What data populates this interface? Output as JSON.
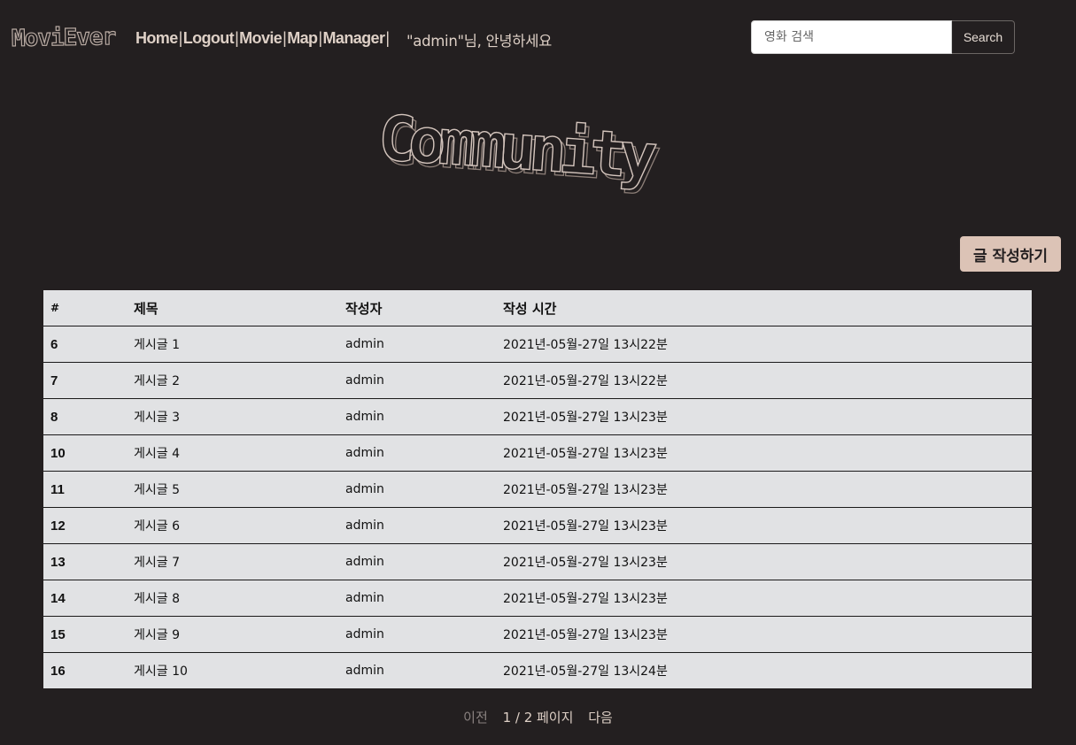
{
  "header": {
    "logo": "MoviEver",
    "nav": [
      "Home",
      "Logout",
      "Movie",
      "Map",
      "Manager"
    ],
    "nav_separator": "|",
    "greeting": "\"admin\"님, 안녕하세요",
    "search": {
      "placeholder": "영화 검색",
      "button_label": "Search"
    }
  },
  "main": {
    "title": "Community",
    "write_button_label": "글 작성하기"
  },
  "table": {
    "columns": [
      "#",
      "제목",
      "작성자",
      "작성 시간"
    ],
    "rows": [
      {
        "num": "6",
        "title": "게시글 1",
        "author": "admin",
        "time": "2021년-05월-27일 13시22분"
      },
      {
        "num": "7",
        "title": "게시글 2",
        "author": "admin",
        "time": "2021년-05월-27일 13시22분"
      },
      {
        "num": "8",
        "title": "게시글 3",
        "author": "admin",
        "time": "2021년-05월-27일 13시23분"
      },
      {
        "num": "10",
        "title": "게시글 4",
        "author": "admin",
        "time": "2021년-05월-27일 13시23분"
      },
      {
        "num": "11",
        "title": "게시글 5",
        "author": "admin",
        "time": "2021년-05월-27일 13시23분"
      },
      {
        "num": "12",
        "title": "게시글 6",
        "author": "admin",
        "time": "2021년-05월-27일 13시23분"
      },
      {
        "num": "13",
        "title": "게시글 7",
        "author": "admin",
        "time": "2021년-05월-27일 13시23분"
      },
      {
        "num": "14",
        "title": "게시글 8",
        "author": "admin",
        "time": "2021년-05월-27일 13시23분"
      },
      {
        "num": "15",
        "title": "게시글 9",
        "author": "admin",
        "time": "2021년-05월-27일 13시23분"
      },
      {
        "num": "16",
        "title": "게시글 10",
        "author": "admin",
        "time": "2021년-05월-27일 13시24분"
      }
    ]
  },
  "pagination": {
    "prev_label": "이전",
    "page_info": "1 / 2 페이지",
    "next_label": "다음"
  },
  "colors": {
    "background": "#231f20",
    "accent": "#dcc3b6",
    "table_bg": "#e1e2e4",
    "nav_text": "#ded0c6"
  }
}
